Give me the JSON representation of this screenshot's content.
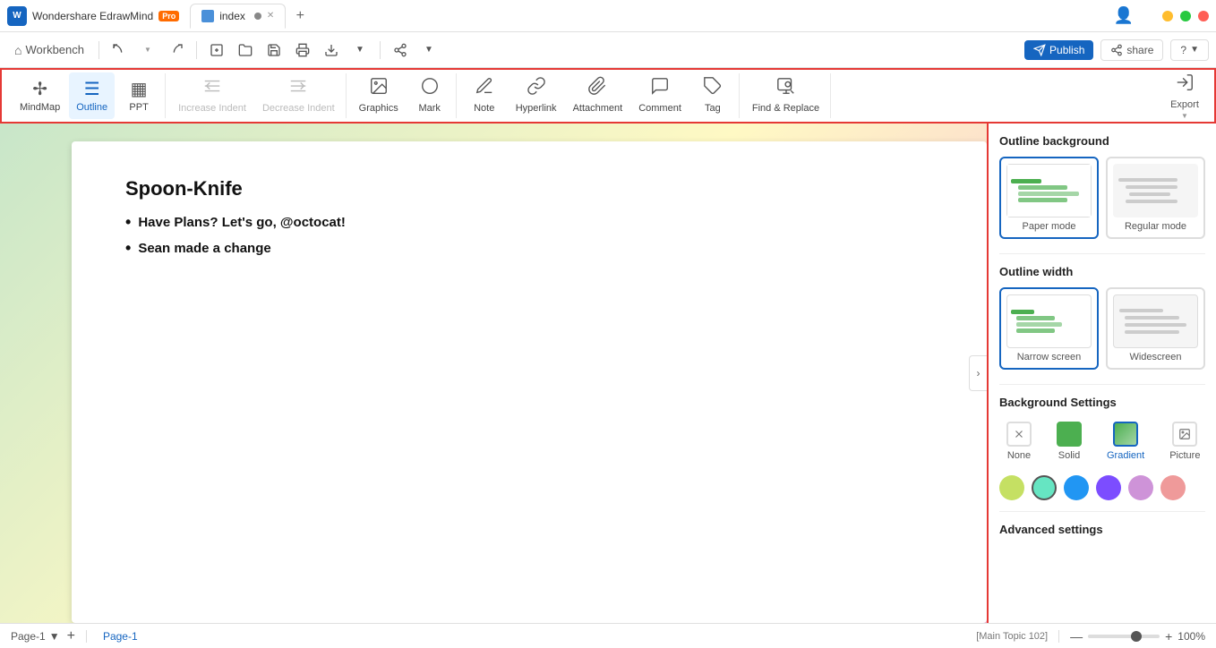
{
  "titlebar": {
    "app_name": "Wondershare EdrawMind",
    "pro_badge": "Pro",
    "tab_name": "index",
    "add_tab_label": "+",
    "window_controls": {
      "minimize": "─",
      "maximize": "□",
      "close": "✕"
    },
    "publish_label": "Publish",
    "share_label": "share",
    "help_label": "?"
  },
  "toolbar": {
    "workbench_label": "Workbench",
    "undo_label": "↩",
    "redo_label": "↪"
  },
  "ribbon": {
    "mindmap_label": "MindMap",
    "outline_label": "Outline",
    "ppt_label": "PPT",
    "increase_indent_label": "Increase Indent",
    "decrease_indent_label": "Decrease Indent",
    "graphics_label": "Graphics",
    "mark_label": "Mark",
    "note_label": "Note",
    "hyperlink_label": "Hyperlink",
    "attachment_label": "Attachment",
    "comment_label": "Comment",
    "tag_label": "Tag",
    "find_replace_label": "Find & Replace",
    "export_label": "Export"
  },
  "canvas": {
    "document_title": "Spoon-Knife",
    "bullet1": "Have Plans? Let's go, @octocat!",
    "bullet2": "Sean made a change"
  },
  "right_panel": {
    "outline_background_title": "Outline background",
    "paper_mode_label": "Paper mode",
    "regular_mode_label": "Regular mode",
    "outline_width_title": "Outline width",
    "narrow_screen_label": "Narrow screen",
    "widescreen_label": "Widescreen",
    "background_settings_title": "Background Settings",
    "bg_none_label": "None",
    "bg_solid_label": "Solid",
    "bg_gradient_label": "Gradient",
    "bg_picture_label": "Picture",
    "advanced_settings_label": "Advanced settings",
    "colors": [
      "#c5e063",
      "#66e5c2",
      "#2196f3",
      "#7c4dff",
      "#ce93d8",
      "#ef9a9a"
    ]
  },
  "statusbar": {
    "page_label": "Page-1",
    "page_tab_label": "Page-1",
    "add_page_label": "+",
    "main_topic_label": "[Main Topic 102]",
    "zoom_minus": "—",
    "zoom_plus": "+",
    "zoom_percent": "100%"
  }
}
